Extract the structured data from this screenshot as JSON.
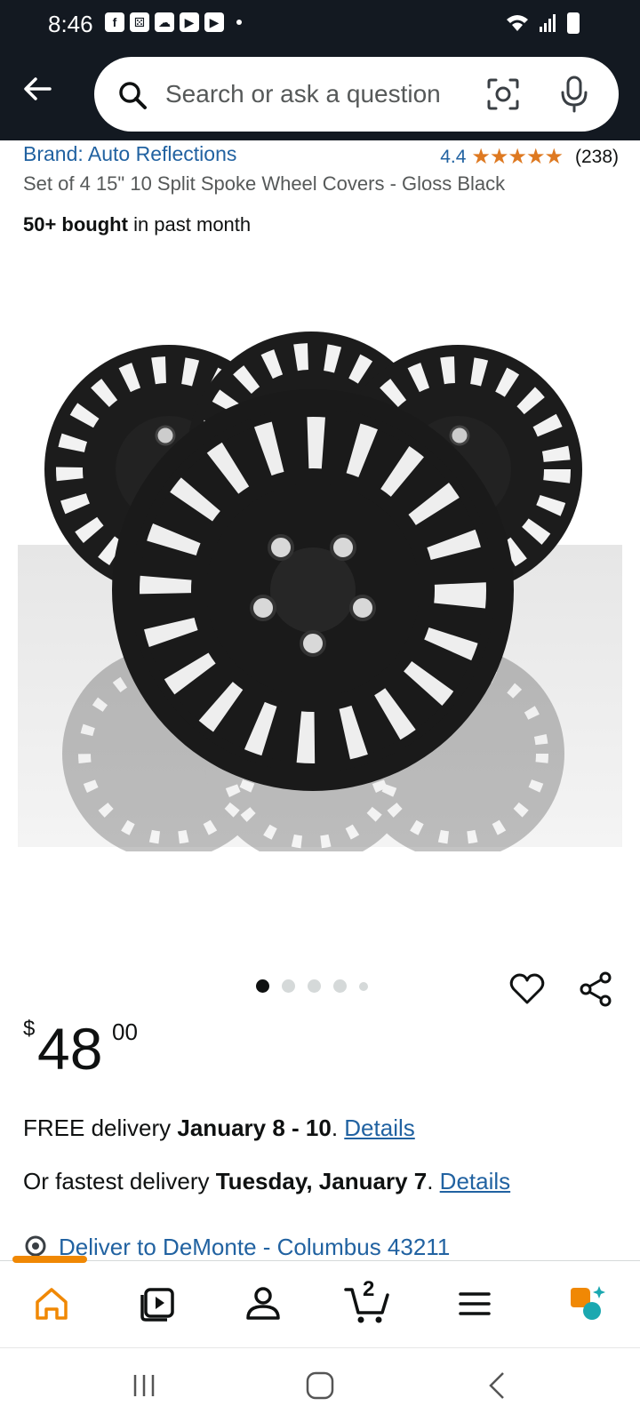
{
  "status": {
    "time": "8:46"
  },
  "search": {
    "placeholder": "Search or ask a question"
  },
  "product": {
    "brand": "Brand: Auto Reflections",
    "rating": "4.4",
    "stars": "★★★★★",
    "review_count": "(238)",
    "title": "Set of 4 15\" 10 Split Spoke Wheel Covers - Gloss Black",
    "bought_bold": "50+ bought",
    "bought_rest": " in past month",
    "image_count": 5,
    "active_image": 1
  },
  "price": {
    "symbol": "$",
    "whole": "48",
    "fraction": "00"
  },
  "delivery": {
    "free_prefix": "FREE delivery ",
    "free_date": "January 8 - 10",
    "free_sep": ". ",
    "free_link": "Details",
    "fast_prefix": "Or fastest delivery ",
    "fast_date": "Tuesday, January 7",
    "fast_sep": ". ",
    "fast_link": "Details",
    "deliver_to": "Deliver to DeMonte - Columbus 43211"
  },
  "bottom_nav": {
    "items": [
      "home-icon",
      "video-icon",
      "account-icon",
      "cart-icon",
      "menu-icon",
      "rufus-icon"
    ],
    "cart_count": "2"
  },
  "colors": {
    "header": "#131921",
    "link": "#2162a1",
    "accent": "#f08804",
    "star": "#de7921"
  }
}
